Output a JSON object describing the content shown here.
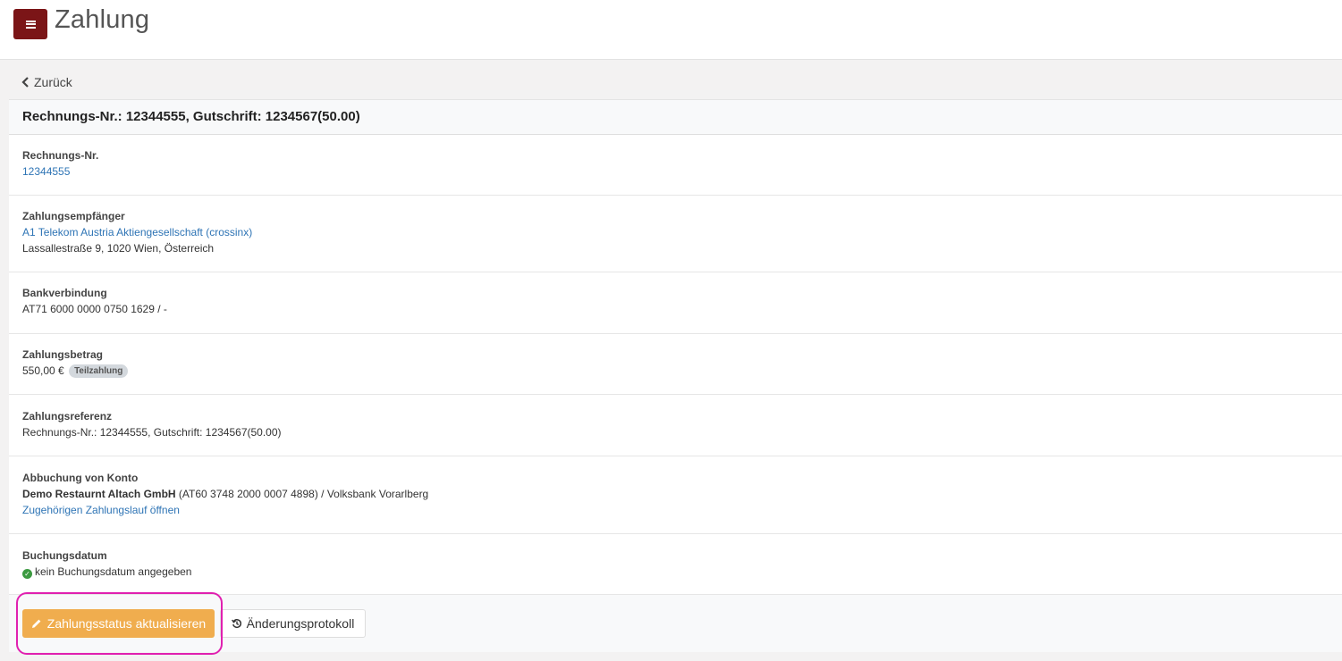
{
  "header": {
    "title": "Zahlung"
  },
  "nav": {
    "back_label": "Zurück"
  },
  "panel": {
    "title_prefix": "Rechnungs-Nr.: ",
    "title_invoice": "12344555",
    "title_mid": ", Gutschrift: ",
    "title_credit": "1234567(50.00)"
  },
  "fields": {
    "invoice": {
      "label": "Rechnungs-Nr.",
      "value": "12344555"
    },
    "payee": {
      "label": "Zahlungsempfänger",
      "name": "A1 Telekom Austria Aktiengesellschaft (crossinx)",
      "address": "Lassallestraße 9, 1020 Wien, Österreich"
    },
    "bank": {
      "label": "Bankverbindung",
      "value": "AT71 6000 0000 0750 1629 / -"
    },
    "amount": {
      "label": "Zahlungsbetrag",
      "value": "550,00 €",
      "badge": "Teilzahlung"
    },
    "reference": {
      "label": "Zahlungsreferenz",
      "value": "Rechnungs-Nr.: 12344555, Gutschrift: 1234567(50.00)"
    },
    "debit": {
      "label": "Abbuchung von Konto",
      "company": "Demo Restaurnt Altach GmbH",
      "detail": " (AT60 3748 2000 0007 4898) / Volksbank Vorarlberg",
      "link": "Zugehörigen Zahlungslauf öffnen"
    },
    "booking": {
      "label": "Buchungsdatum",
      "value": "kein Buchungsdatum angegeben"
    }
  },
  "actions": {
    "update_status": "Zahlungsstatus aktualisieren",
    "change_log": "Änderungsprotokoll"
  },
  "colors": {
    "brand": "#7b1517",
    "link": "#2e74b5",
    "warning": "#f0ad4e",
    "highlight": "#e020b0",
    "success": "#3c9a41"
  },
  "icons": [
    "menu-icon",
    "chevron-left-icon",
    "check-circle-icon",
    "pencil-icon",
    "history-icon"
  ]
}
